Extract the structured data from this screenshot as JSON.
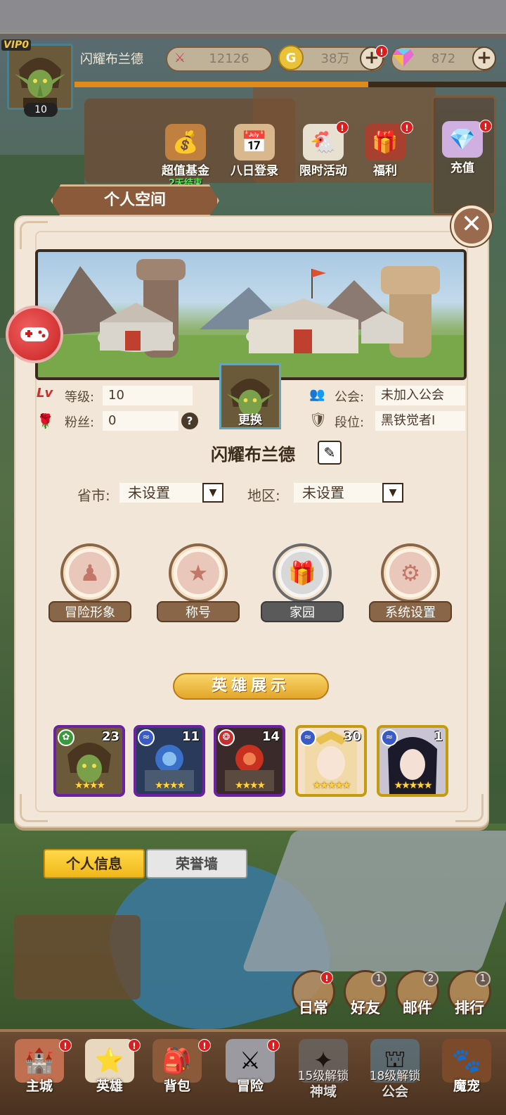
{
  "header": {
    "vip_prefix": "VIP",
    "vip_level": "0",
    "player_level": "10",
    "player_name": "闪耀布兰德",
    "power": "12126",
    "gold": "38万",
    "gems": "872",
    "exp_progress": 0.68
  },
  "events": [
    {
      "label": "超值基金",
      "icon": "fund-icon"
    },
    {
      "label": "八日登录",
      "icon": "calendar-icon"
    },
    {
      "label": "限时活动",
      "icon": "limited-event-icon"
    },
    {
      "label": "福利",
      "icon": "welfare-icon"
    }
  ],
  "recharge_label": "充值",
  "fund_timer": "2天结束",
  "modal": {
    "title": "个人空间",
    "level_label": "等级:",
    "level_value": "10",
    "fans_label": "粉丝:",
    "fans_value": "0",
    "guild_label": "公会:",
    "guild_value": "未加入公会",
    "rank_label": "段位:",
    "rank_value": "黑铁觉者Ⅰ",
    "portrait_label": "更换",
    "player_name": "闪耀布兰德",
    "province_label": "省市:",
    "province_value": "未设置",
    "region_label": "地区:",
    "region_value": "未设置"
  },
  "functions": [
    {
      "label": "冒险形象",
      "enabled": true
    },
    {
      "label": "称号",
      "enabled": true
    },
    {
      "label": "家园",
      "enabled": false
    },
    {
      "label": "系统设置",
      "enabled": true
    }
  ],
  "hero_showcase": {
    "title": "英雄展示",
    "heroes": [
      {
        "level": "23",
        "rarity": "purple",
        "element": "nature",
        "stars": 4
      },
      {
        "level": "11",
        "rarity": "purple",
        "element": "wind",
        "stars": 4
      },
      {
        "level": "14",
        "rarity": "purple",
        "element": "fire",
        "stars": 4
      },
      {
        "level": "30",
        "rarity": "gold",
        "element": "wind",
        "stars": 5
      },
      {
        "level": "1",
        "rarity": "gold",
        "element": "wind",
        "stars": 5
      }
    ]
  },
  "tabs": {
    "personal_info": "个人信息",
    "honor_wall": "荣誉墙"
  },
  "side_buttons": [
    {
      "label": "日常",
      "badge": "!"
    },
    {
      "label": "好友",
      "badge": "1"
    },
    {
      "label": "邮件",
      "badge": "2"
    },
    {
      "label": "排行",
      "badge": "1"
    }
  ],
  "nav": {
    "main_city": "主城",
    "hero": "英雄",
    "bag": "背包",
    "adventure": "冒险",
    "divine_lock": "15级解锁",
    "divine": "神域",
    "guild_lock": "18级解锁",
    "guild": "公会",
    "pet": "魔宠"
  },
  "colors": {
    "panel": "#f1e6d8",
    "accent_brown": "#8a6648",
    "active_tab": "#f0b81a",
    "purple_rarity": "#8a3ec0",
    "gold_rarity": "#f2cc2a",
    "alert_red": "#d82020"
  }
}
